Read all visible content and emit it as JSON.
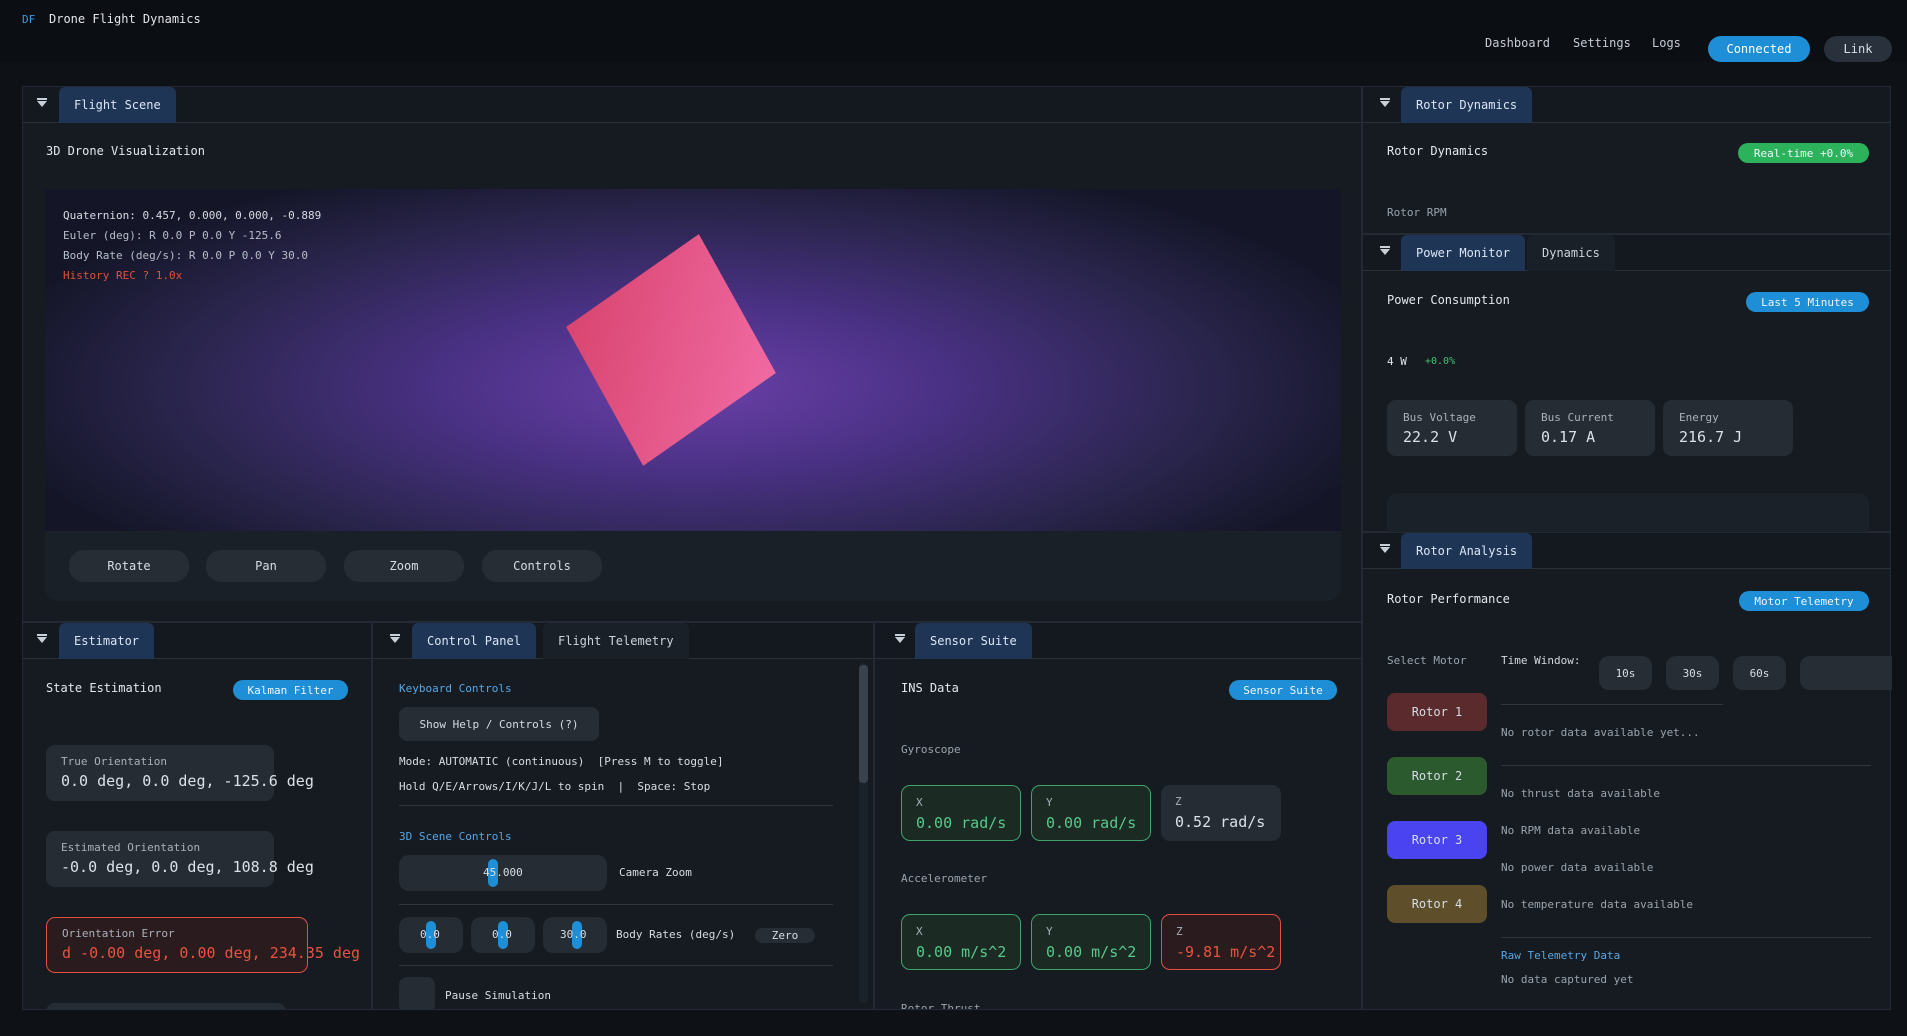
{
  "header": {
    "logo": "DF",
    "title": "Drone Flight Dynamics",
    "nav": [
      "Dashboard",
      "Settings",
      "Logs"
    ],
    "connected": "Connected",
    "link": "Link"
  },
  "flight_scene": {
    "tab": "Flight Scene",
    "title": "3D Drone Visualization",
    "overlay": {
      "quaternion": "Quaternion: 0.457, 0.000, 0.000, -0.889",
      "euler": "Euler (deg): R 0.0  P 0.0  Y -125.6",
      "body_rate": "Body Rate (deg/s): R 0.0  P 0.0  Y 30.0",
      "history": "History REC ? 1.0x"
    },
    "buttons": [
      "Rotate",
      "Pan",
      "Zoom",
      "Controls"
    ]
  },
  "rotor_dynamics": {
    "tab": "Rotor Dynamics",
    "title": "Rotor Dynamics",
    "badge": "Real-time +0.0%",
    "rpm_label": "Rotor RPM"
  },
  "power_monitor": {
    "tabs": [
      "Power Monitor",
      "Dynamics"
    ],
    "title": "Power Consumption",
    "badge": "Last 5 Minutes",
    "power_value": "4 W",
    "power_change": "+0.0%",
    "cards": [
      {
        "label": "Bus Voltage",
        "value": "22.2 V"
      },
      {
        "label": "Bus Current",
        "value": "0.17 A"
      },
      {
        "label": "Energy",
        "value": "216.7 J"
      }
    ]
  },
  "rotor_analysis": {
    "tab": "Rotor Analysis",
    "title": "Rotor Performance",
    "badge": "Motor Telemetry",
    "select_motor": "Select Motor",
    "time_window": "Time Window:",
    "time_options": [
      "10s",
      "30s",
      "60s"
    ],
    "rotors": [
      "Rotor 1",
      "Rotor 2",
      "Rotor 3",
      "Rotor 4"
    ],
    "rotor_colors": [
      "#5a2a2c",
      "#2c5a2f",
      "#4a44f0",
      "#5e4f2a"
    ],
    "messages": {
      "rotor": "No rotor data available yet...",
      "thrust": "No thrust data available",
      "rpm": "No RPM data available",
      "power": "No power data available",
      "temp": "No temperature data available"
    },
    "raw_title": "Raw Telemetry Data",
    "raw_msg": "No data captured yet"
  },
  "estimator": {
    "tab": "Estimator",
    "title": "State Estimation",
    "badge": "Kalman Filter",
    "true_label": "True Orientation",
    "true_value": "0.0 deg, 0.0 deg, -125.6 deg",
    "est_label": "Estimated Orientation",
    "est_value": "-0.0 deg, 0.0 deg, 108.8 deg",
    "err_label": "Orientation Error",
    "err_value": "d -0.00 deg, 0.00 deg, 234.35 deg"
  },
  "control_panel": {
    "tabs": [
      "Control Panel",
      "Flight Telemetry"
    ],
    "keyboard_title": "Keyboard Controls",
    "help_button": "Show Help / Controls (?)",
    "mode_text": "Mode: AUTOMATIC (continuous)  [Press M to toggle]",
    "spin_text": "Hold Q/E/Arrows/I/K/J/L to spin  |  Space: Stop",
    "scene_title": "3D Scene Controls",
    "zoom_value": "45.000",
    "zoom_label": "Camera Zoom",
    "rates": [
      "0.0",
      "0.0",
      "30.0"
    ],
    "rates_label": "Body Rates (deg/s)",
    "zero": "Zero",
    "pause": "Pause Simulation"
  },
  "sensor_suite": {
    "tab": "Sensor Suite",
    "title": "INS Data",
    "badge": "Sensor Suite",
    "gyro_title": "Gyroscope",
    "gyro": [
      {
        "axis": "X",
        "value": "0.00 rad/s"
      },
      {
        "axis": "Y",
        "value": "0.00 rad/s"
      },
      {
        "axis": "Z",
        "value": "0.52 rad/s"
      }
    ],
    "accel_title": "Accelerometer",
    "accel": [
      {
        "axis": "X",
        "value": "0.00 m/s^2"
      },
      {
        "axis": "Y",
        "value": "0.00 m/s^2"
      },
      {
        "axis": "Z",
        "value": "-9.81 m/s^2"
      }
    ],
    "thrust_title": "Rotor Thrust"
  },
  "colors": {
    "accent_blue": "#1e8fd6",
    "green_badge": "#2bb25a",
    "tab_active": "#1f3556",
    "error_red": "#e0503c",
    "ok_green": "#3fa36a"
  }
}
